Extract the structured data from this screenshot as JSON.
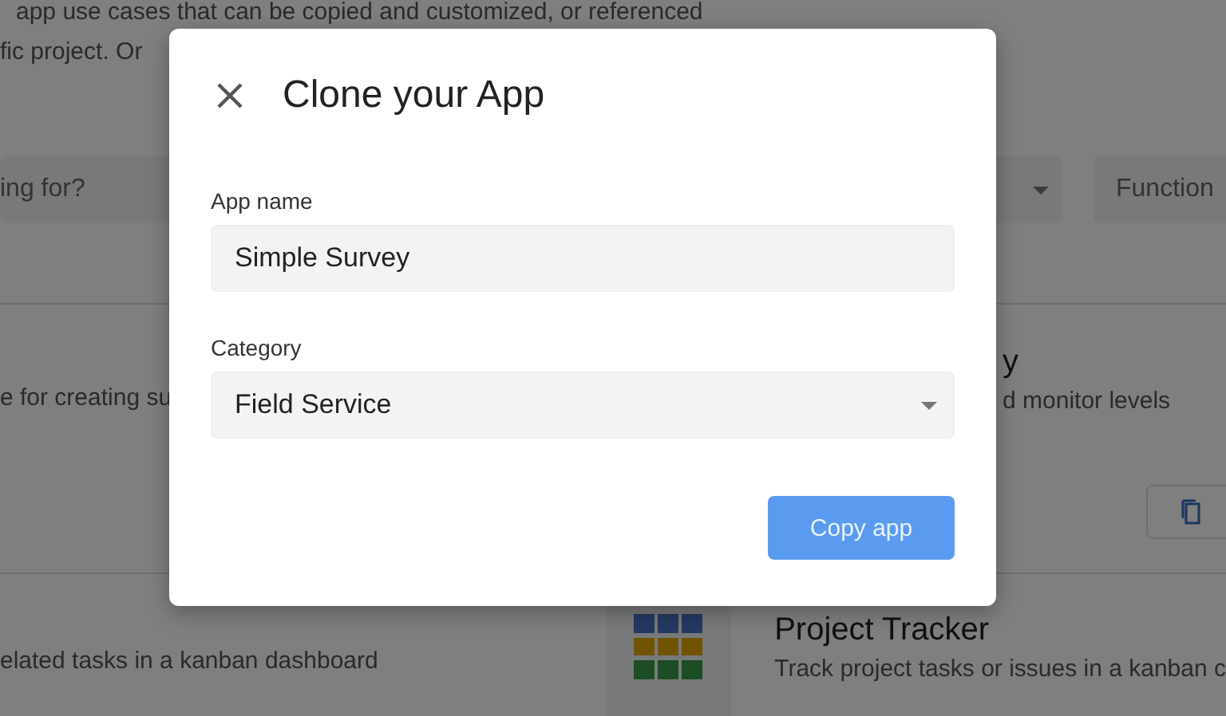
{
  "background": {
    "intro_lines": [
      "app use cases that can be copied and customized, or referenced",
      "fic project. Or"
    ],
    "search": {
      "placeholder": "ing for?"
    },
    "filter_chip": "Function",
    "rows": [
      {
        "left_description": "e for creating su",
        "right_title": "y",
        "right_description": "d monitor levels",
        "right_has_icon": false
      },
      {
        "left_description": "elated tasks in a kanban dashboard",
        "right_title": "Project Tracker",
        "right_description": "Track project tasks or issues in a kanban c",
        "right_has_icon": true
      }
    ]
  },
  "dialog": {
    "title": "Clone your App",
    "fields": [
      {
        "kind": "text",
        "label": "App name",
        "value": "Simple Survey"
      },
      {
        "kind": "select",
        "label": "Category",
        "value": "Field Service"
      }
    ],
    "primary_button": "Copy app"
  }
}
